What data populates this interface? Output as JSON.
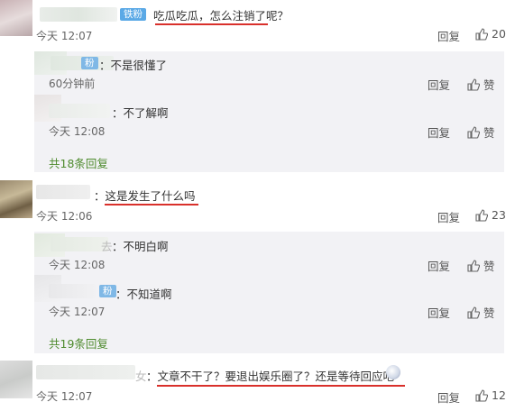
{
  "labels": {
    "reply": "回复",
    "like": "赞"
  },
  "comments": [
    {
      "badge": "铁粉",
      "text": "吃瓜吃瓜，怎么注销了呢？",
      "time": "今天 12:07",
      "likes": "20",
      "replies": [
        {
          "badge": "粉",
          "text": "：不是很懂了",
          "time": "60分钟前",
          "likes": "赞"
        },
        {
          "text": "：不了解啊",
          "time": "今天 12:08",
          "likes": "赞"
        }
      ],
      "more": "共18条回复"
    },
    {
      "text": "：这是发生了什么吗",
      "time": "今天 12:06",
      "likes": "23",
      "replies": [
        {
          "name_tail": "去",
          "text": "：不明白啊",
          "time": "今天 12:08",
          "likes": "赞"
        },
        {
          "badge": "粉",
          "text": "：不知道啊",
          "time": "今天 12:07",
          "likes": "赞"
        }
      ],
      "more": "共19条回复"
    },
    {
      "name_tail": "女",
      "text": "：文章不干了？要退出娱乐圈了？还是等待回应吧",
      "time": "今天 12:07",
      "likes": "12"
    }
  ],
  "colors": {
    "underline": "#d9302b",
    "more_link": "#4e8b2e",
    "badge": "#5ba9e6",
    "reply_bg": "#f2f2f5"
  }
}
